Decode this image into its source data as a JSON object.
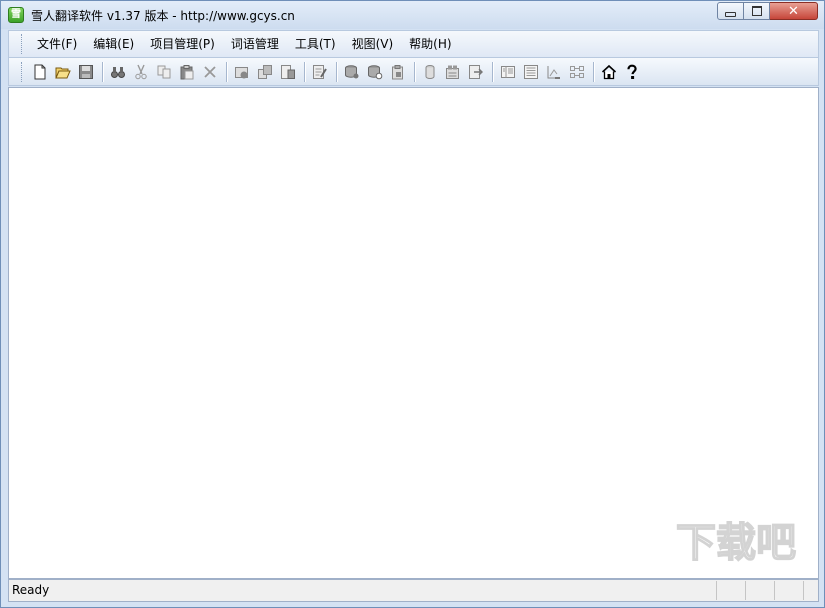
{
  "window": {
    "title": "雪人翻译软件 v1.37 版本 - http://www.gcys.cn",
    "app_icon": "snowman-app-icon",
    "app_icon_glyph": "雪"
  },
  "caption_buttons": {
    "close_glyph": "✕"
  },
  "menu": [
    {
      "label": "文件(F)"
    },
    {
      "label": "编辑(E)"
    },
    {
      "label": "项目管理(P)"
    },
    {
      "label": "词语管理"
    },
    {
      "label": "工具(T)"
    },
    {
      "label": "视图(V)"
    },
    {
      "label": "帮助(H)"
    }
  ],
  "toolbar": {
    "groups": [
      [
        "new-file-icon",
        "open-folder-icon",
        "save-icon"
      ],
      [
        "find-icon",
        "cut-icon",
        "copy-icon",
        "paste-icon",
        "delete-icon"
      ],
      [
        "project-new-icon",
        "project-copy-icon",
        "project-export-icon"
      ],
      [
        "edit-document-icon"
      ],
      [
        "db-add-icon",
        "db-settings-icon",
        "db-clipboard-icon"
      ],
      [
        "database-icon",
        "batch-translate-icon",
        "insert-icon"
      ],
      [
        "view-panes-icon",
        "view-list-icon",
        "view-align-icon",
        "view-compare-icon"
      ],
      [
        "home-icon",
        "help-icon"
      ]
    ]
  },
  "status": {
    "text": "Ready"
  },
  "colors": {
    "chrome": "#d4e2f3",
    "client": "#ffffff",
    "close_button": "#c6463a"
  }
}
